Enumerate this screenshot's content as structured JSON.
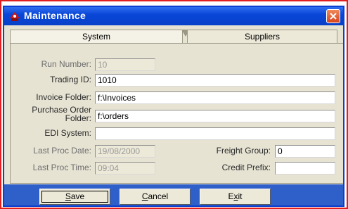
{
  "window": {
    "title": "Maintenance"
  },
  "tabs": [
    {
      "label": "System",
      "active": true
    },
    {
      "label": "Suppliers",
      "active": false
    }
  ],
  "form": {
    "run_number": {
      "label": "Run Number:",
      "value": "10",
      "enabled": false
    },
    "trading_id": {
      "label": "Trading ID:",
      "value": "1010",
      "enabled": true
    },
    "invoice_folder": {
      "label": "Invoice Folder:",
      "value": "f:\\Invoices",
      "enabled": true
    },
    "purchase_order_folder": {
      "label_line1": "Purchase Order",
      "label_line2": "Folder:",
      "value": "f:\\orders",
      "enabled": true
    },
    "edi_system": {
      "label": "EDI System:",
      "value": "",
      "enabled": true
    },
    "last_proc_date": {
      "label": "Last Proc Date:",
      "value": "19/08/2000",
      "enabled": false
    },
    "last_proc_time": {
      "label": "Last Proc Time:",
      "value": "09:04",
      "enabled": false
    },
    "freight_group": {
      "label": "Freight Group:",
      "value": "0",
      "enabled": true
    },
    "credit_prefix": {
      "label": "Credit Prefix:",
      "value": "",
      "enabled": true
    }
  },
  "buttons": {
    "save": {
      "mnemonic": "S",
      "rest": "ave"
    },
    "cancel": {
      "mnemonic": "C",
      "rest": "ancel"
    },
    "exit": {
      "first": "E",
      "mnemonic": "x",
      "rest": "it"
    }
  },
  "colors": {
    "titlebar": "#0a47d8",
    "window_bg": "#e6e3d3",
    "close": "#d8431c",
    "outer_frame": "#e02020"
  },
  "icons": {
    "app": "app-logo-icon",
    "close": "close-icon"
  }
}
